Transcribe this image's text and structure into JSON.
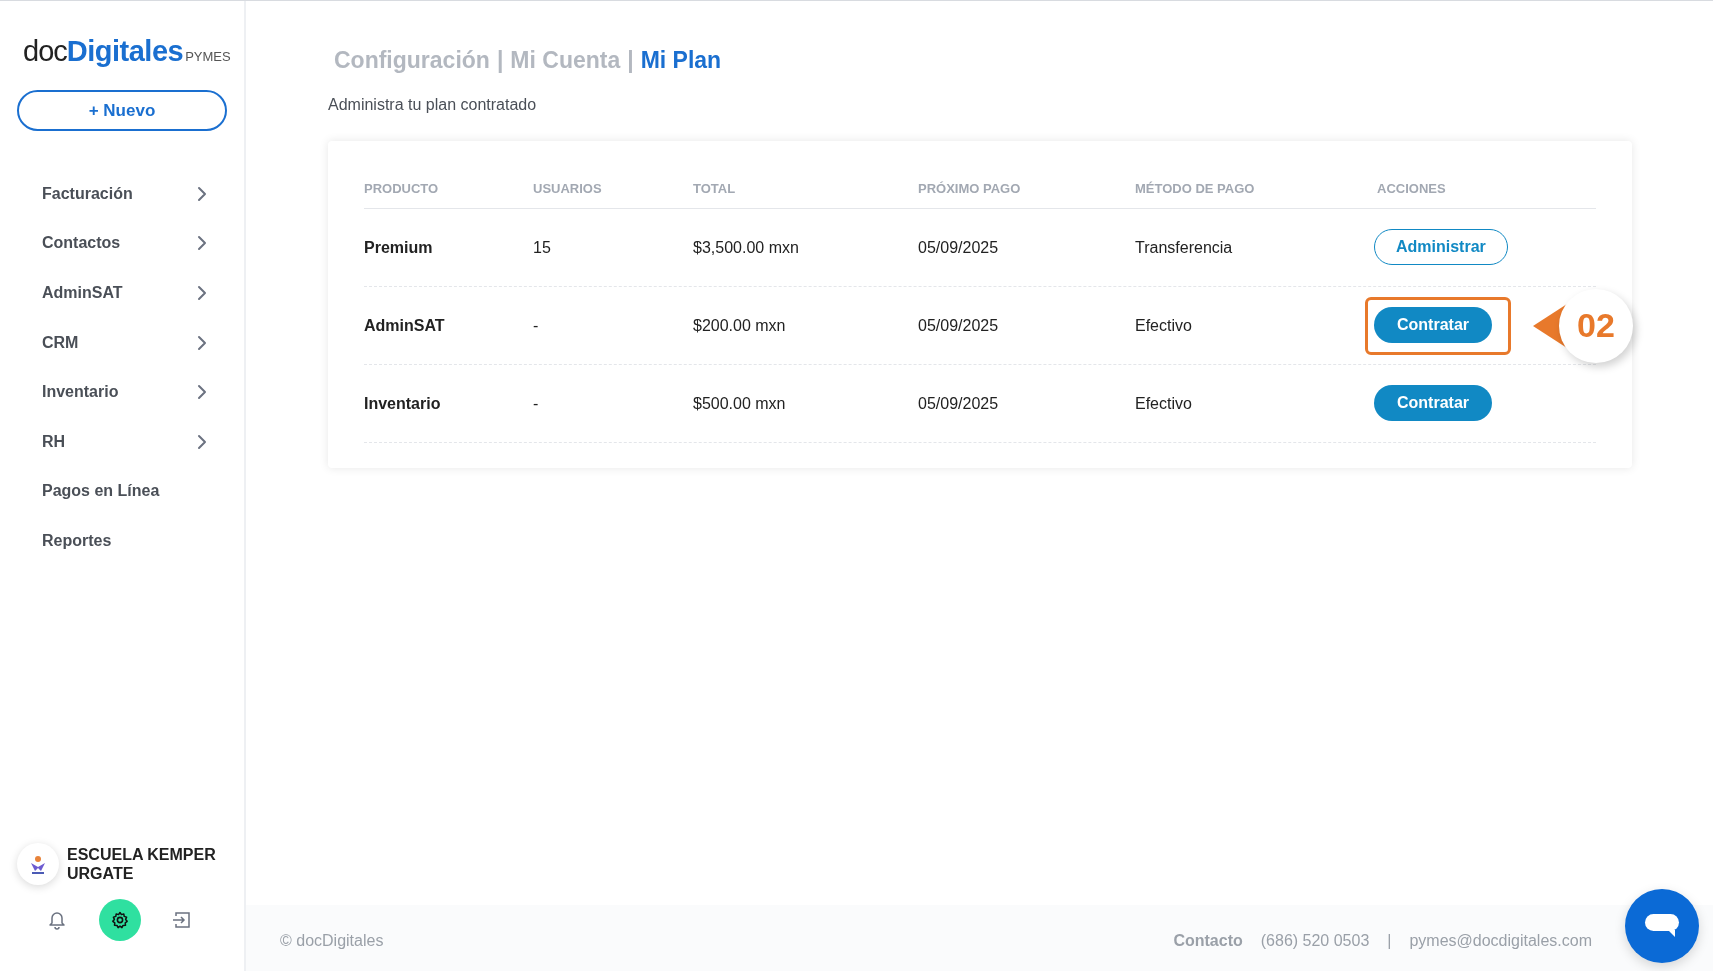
{
  "sidebar": {
    "logo": {
      "prefix": "doc",
      "brand": "Digitales",
      "suffix": "PYMES"
    },
    "new_button": "+ Nuevo",
    "items": [
      {
        "label": "Facturación",
        "expandable": true
      },
      {
        "label": "Contactos",
        "expandable": true
      },
      {
        "label": "AdminSAT",
        "expandable": true
      },
      {
        "label": "CRM",
        "expandable": true
      },
      {
        "label": "Inventario",
        "expandable": true
      },
      {
        "label": "RH",
        "expandable": true
      },
      {
        "label": "Pagos en Línea",
        "expandable": false
      },
      {
        "label": "Reportes",
        "expandable": false
      }
    ],
    "account": {
      "name": "ESCUELA KEMPER URGATE"
    },
    "bottom_icons": [
      {
        "kind": "bell",
        "selected": false
      },
      {
        "kind": "gear",
        "selected": true
      },
      {
        "kind": "logout",
        "selected": false
      }
    ]
  },
  "breadcrumb": [
    {
      "label": "Configuración",
      "selected": false
    },
    {
      "label": "Mi Cuenta",
      "selected": false
    },
    {
      "label": "Mi Plan",
      "selected": true
    }
  ],
  "breadcrumb_separator": "|",
  "subtitle": "Administra tu plan contratado",
  "table": {
    "columns": [
      "PRODUCTO",
      "USUARIOS",
      "TOTAL",
      "PRÓXIMO PAGO",
      "MÉTODO DE PAGO",
      "ACCIONES"
    ],
    "rows": [
      {
        "product": "Premium",
        "users": "15",
        "total": "$3,500.00 mxn",
        "next_payment": "05/09/2025",
        "method": "Transferencia",
        "action": {
          "label": "Administrar",
          "kind": "outline",
          "highlighted": false
        }
      },
      {
        "product": "AdminSAT",
        "users": "-",
        "total": "$200.00 mxn",
        "next_payment": "05/09/2025",
        "method": "Efectivo",
        "action": {
          "label": "Contratar",
          "kind": "filled",
          "highlighted": true
        }
      },
      {
        "product": "Inventario",
        "users": "-",
        "total": "$500.00 mxn",
        "next_payment": "05/09/2025",
        "method": "Efectivo",
        "action": {
          "label": "Contratar",
          "kind": "filled",
          "highlighted": false
        }
      }
    ]
  },
  "annotation": {
    "label": "02"
  },
  "footer": {
    "copyright": "© docDigitales",
    "contact_label": "Contacto",
    "phone": "(686) 520 0503",
    "separator": "|",
    "email": "pymes@docdigitales.com"
  }
}
